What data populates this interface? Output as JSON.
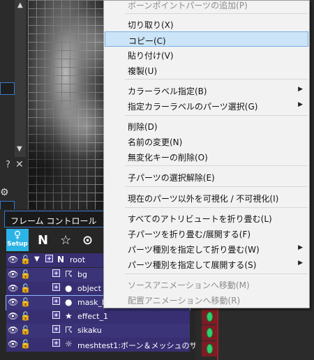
{
  "context_menu": {
    "items": [
      {
        "label": "ボーンポイントパーツの追加(P)",
        "disabled": true
      },
      {
        "label": "切り取り(X)"
      },
      {
        "label": "コピー(C)",
        "highlighted": true
      },
      {
        "label": "貼り付け(V)"
      },
      {
        "label": "複製(U)"
      },
      {
        "label": "カラーラベル指定(B)",
        "submenu": true
      },
      {
        "label": "指定カラーラベルのパーツ選択(G)",
        "submenu": true
      },
      {
        "label": "削除(D)"
      },
      {
        "label": "名前の変更(N)"
      },
      {
        "label": "無変化キーの削除(O)"
      },
      {
        "label": "子パーツの選択解除(E)"
      },
      {
        "label": "現在のパーツ以外を可視化 / 不可視化(I)"
      },
      {
        "label": "すべてのアトリビュートを折り畳む(L)"
      },
      {
        "label": "子パーツを折り畳む/展開する(F)"
      },
      {
        "label": "パーツ種別を指定して折り畳む(W)",
        "submenu": true
      },
      {
        "label": "パーツ種別を指定して展開する(S)",
        "submenu": true
      },
      {
        "label": "ソースアニメーションへ移動(M)",
        "disabled": true
      },
      {
        "label": "配置アニメーションへ移動(R)",
        "disabled": true
      }
    ],
    "submenu_arrow": "▶"
  },
  "frame_control": {
    "title": "フレーム コントロール",
    "setup_label": "Setup",
    "tools": [
      {
        "name": "new-null-part-icon",
        "glyph": "N"
      },
      {
        "name": "new-effect-part-icon",
        "glyph": "☆"
      },
      {
        "name": "new-bone-part-icon",
        "glyph": "⊙"
      }
    ]
  },
  "layers": [
    {
      "name": "root",
      "type": "null",
      "glyph": "N"
    },
    {
      "name": "bg",
      "type": "bone",
      "glyph": "☈"
    },
    {
      "name": "object",
      "type": "normal",
      "glyph": "●"
    },
    {
      "name": "mask_l",
      "type": "mask",
      "glyph": "●"
    },
    {
      "name": "effect_1",
      "type": "effect",
      "glyph": "★"
    },
    {
      "name": "sikaku",
      "type": "bone",
      "glyph": "☈"
    },
    {
      "name": "meshtest1:ボーン＆メッシュのサ",
      "type": "mesh",
      "glyph": "☼"
    }
  ],
  "left_strip": {
    "help": "?",
    "close": "✕"
  },
  "colors": {
    "accent": "#2bb4e6",
    "layer_bg": "#372f72",
    "highlight": "#cce4f7",
    "key_green": "#2ed06b"
  }
}
